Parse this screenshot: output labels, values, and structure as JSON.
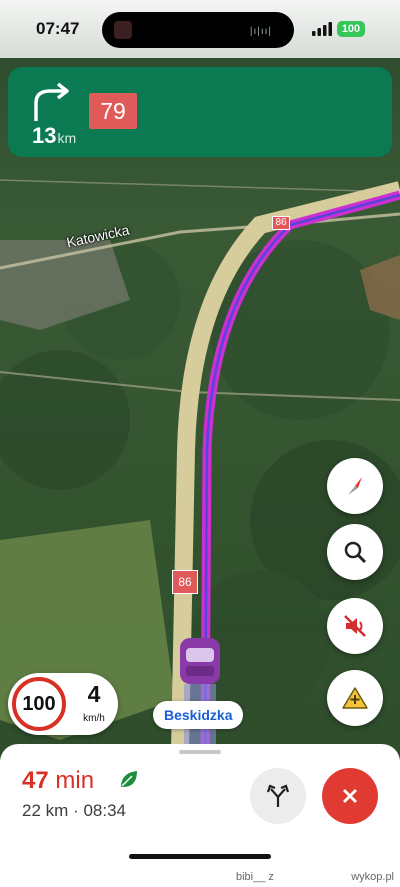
{
  "status_bar": {
    "time": "07:47",
    "battery": "100"
  },
  "navigation": {
    "next_turn": {
      "icon": "turn-right-icon",
      "distance_value": "13",
      "distance_unit": "km",
      "road_number": "79"
    }
  },
  "map": {
    "road_label": "Katowicka",
    "route_shields": [
      "86",
      "86"
    ],
    "street_name": "Beskidzka",
    "colors": {
      "route": "#cc2fd2",
      "banner": "#0b7a52",
      "road_shield": "#e05a5a"
    }
  },
  "controls": {
    "compass": "compass-icon",
    "search": "search-icon",
    "mute": "mute-icon",
    "report": "report-incident-icon"
  },
  "speed": {
    "limit": "100",
    "current": "4",
    "unit": "km/h"
  },
  "trip": {
    "eta_value": "47",
    "eta_unit": "min",
    "distance": "22 km",
    "separator": "·",
    "arrival": "08:34",
    "alt_routes": "alternate-routes-icon",
    "exit": "close-icon"
  },
  "watermark": {
    "user": "bibi__ z",
    "site": "wykop.pl"
  }
}
